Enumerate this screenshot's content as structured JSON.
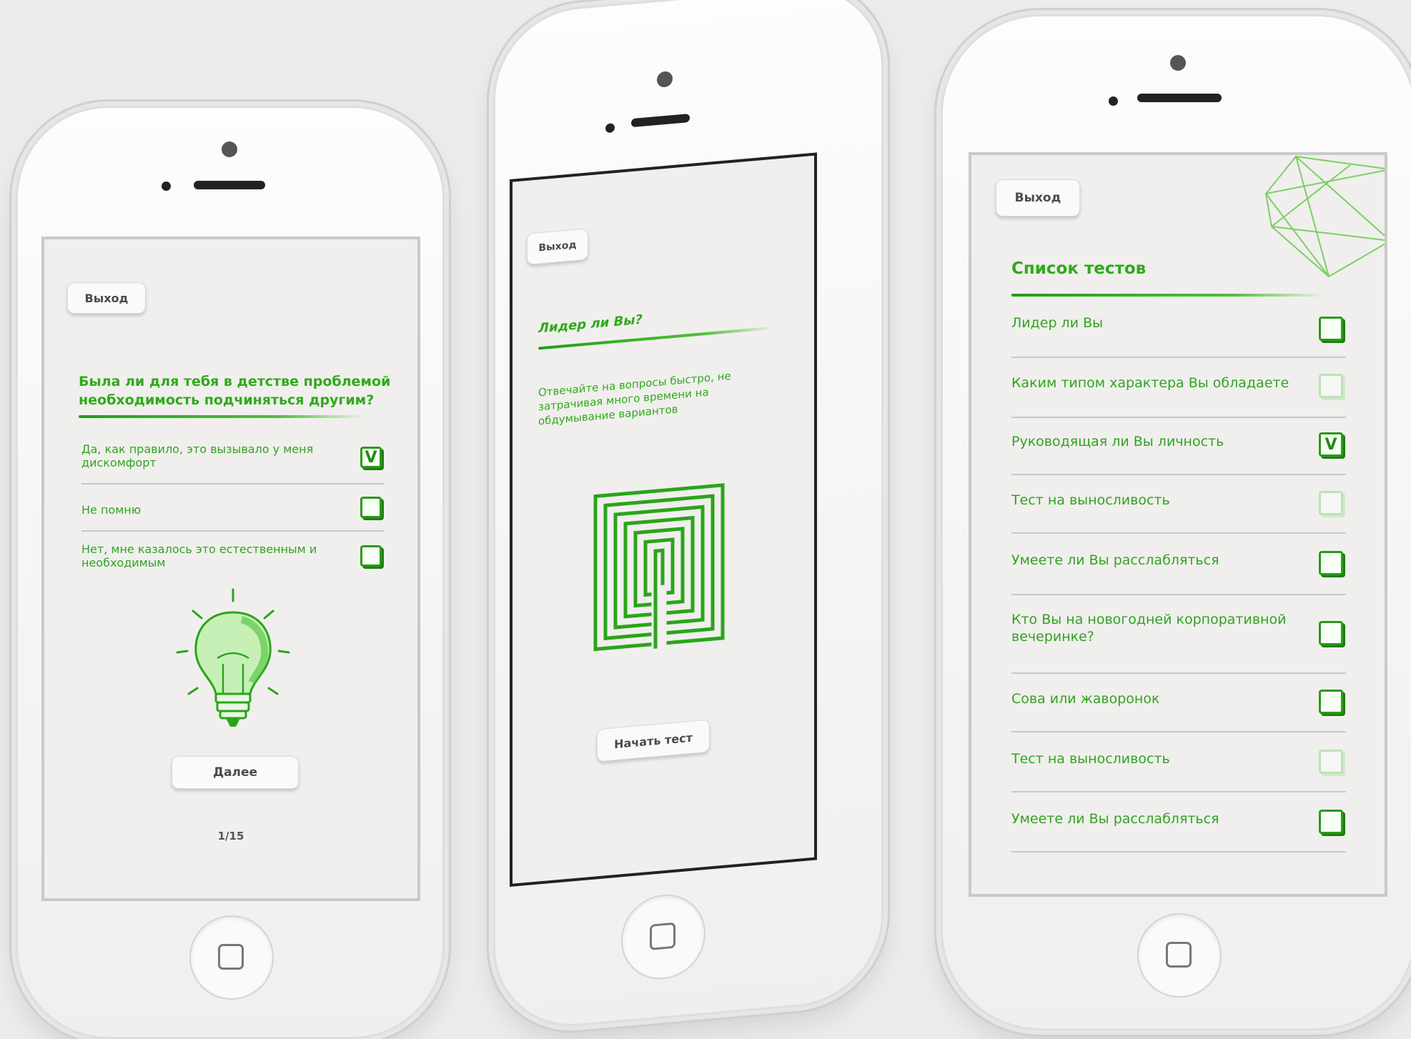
{
  "phone1": {
    "exit_label": "Выход",
    "question": "Была ли для тебя в детстве проблемой необходимость подчиняться другим?",
    "options": [
      {
        "label": "Да, как правило, это вызывало у меня дискомфорт",
        "checked": true
      },
      {
        "label": "Не помню",
        "checked": false
      },
      {
        "label": "Нет, мне казалось это естественным и необходимым",
        "checked": false
      }
    ],
    "check_mark": "V",
    "illustration_icon": "lightbulb-icon",
    "next_label": "Далее",
    "progress": "1/15"
  },
  "phone2": {
    "exit_label": "Выход",
    "title": "Лидер ли Вы?",
    "description": "Отвечайте на вопросы быстро, не затрачивая много времени на обдумывание вариантов",
    "illustration_icon": "maze-icon",
    "start_label": "Начать тест"
  },
  "phone3": {
    "exit_label": "Выход",
    "title": "Список тестов",
    "decor_icon": "polygon-wireframe-icon",
    "check_mark": "V",
    "items": [
      {
        "label": "Лидер ли Вы",
        "state": "empty"
      },
      {
        "label": "Каким типом характера Вы обладаете",
        "state": "faint"
      },
      {
        "label": "Руководящая ли Вы личность",
        "state": "checked"
      },
      {
        "label": "Тест на выносливость",
        "state": "faint"
      },
      {
        "label": "Умеете ли Вы расслабляться",
        "state": "empty"
      },
      {
        "label": "Кто Вы на новогодней корпоративной вечеринке?",
        "state": "empty"
      },
      {
        "label": "Сова или жаворонок",
        "state": "empty"
      },
      {
        "label": "Тест на выносливость",
        "state": "faint"
      },
      {
        "label": "Умеете ли Вы расслабляться",
        "state": "empty"
      }
    ]
  },
  "colors": {
    "accent_green": "#2faa1a",
    "dark_green": "#1e7e10",
    "screen_bg": "#f0efed",
    "page_bg": "#ececec"
  }
}
